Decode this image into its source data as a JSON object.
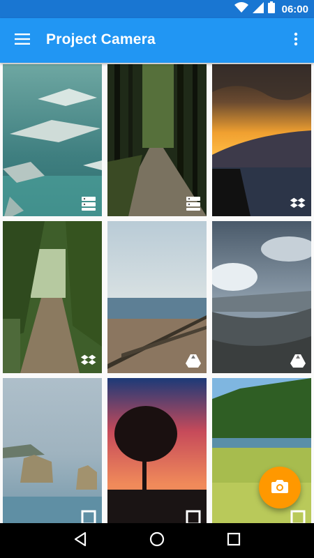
{
  "status_bar": {
    "time": "06:00",
    "icons": [
      "wifi-icon",
      "cell-signal-icon",
      "battery-icon"
    ]
  },
  "app_bar": {
    "title": "Project Camera",
    "icons": [
      "menu-icon",
      "more-vert-icon"
    ]
  },
  "photos": [
    {
      "scene": "manta rays swimming in aquarium",
      "source_icon": "server-icon"
    },
    {
      "scene": "forest path between tall pines",
      "source_icon": "server-icon"
    },
    {
      "scene": "orange sunset over mountain and sea",
      "source_icon": "dropbox-icon"
    },
    {
      "scene": "jungle trail",
      "source_icon": "dropbox-icon"
    },
    {
      "scene": "beach with wooden groynes",
      "source_icon": "google-drive-icon"
    },
    {
      "scene": "mountain valley under clouds",
      "source_icon": "google-drive-icon"
    },
    {
      "scene": "sea stacks on coast",
      "source_icon": "square-icon"
    },
    {
      "scene": "tree silhouette at red sunset",
      "source_icon": "square-icon"
    },
    {
      "scene": "green meadow by mountain lake",
      "source_icon": "square-icon"
    }
  ],
  "fab": {
    "icon": "camera-icon",
    "color": "#ff9800"
  },
  "nav_bar": {
    "icons": [
      "back-icon",
      "home-icon",
      "recents-icon"
    ]
  },
  "colors": {
    "primary": "#2196f3",
    "primary_dark": "#1976d2",
    "accent": "#ff9800"
  }
}
